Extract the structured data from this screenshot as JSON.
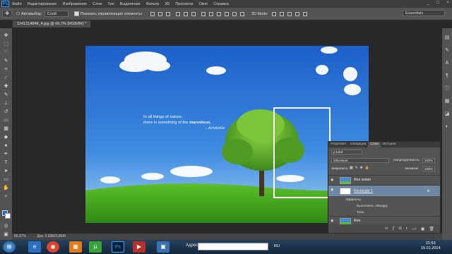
{
  "menu": {
    "items": [
      "Файл",
      "Редактирование",
      "Изображение",
      "Слои",
      "Тип",
      "Выделение",
      "Фильтр",
      "3D",
      "Просмотр",
      "Окно",
      "Справка"
    ]
  },
  "window_controls": [
    "_",
    "□",
    "×"
  ],
  "options_bar": {
    "auto_select_label": "Автовыбор:",
    "auto_select_value": "Слой",
    "show_controls_label": "Показать управляющие элементы",
    "mode_3d_label": "3D Mode:",
    "workspace": "Essentials"
  },
  "document": {
    "tab_title": "1241214848_4.jpg @ 66,7% (RGB/8#) *"
  },
  "canvas": {
    "quote_line1": "In all things of nature,",
    "quote_line2_pre": "there is something of the ",
    "quote_line2_bold": "marvelous.",
    "quote_signature": "- Aristotle"
  },
  "status": {
    "zoom": "66,67%",
    "doc_size": "Док: 2,93М/3,86М"
  },
  "layers_panel": {
    "tabs": [
      "Properties",
      "Операции",
      "Слои",
      "История"
    ],
    "active_tab": "Слои",
    "kind_label": "Kind",
    "blend_mode": "Обычные",
    "opacity_label": "Непрозрачность:",
    "opacity_value": "100%",
    "lock_label": "Закрепить:",
    "fill_label": "Заливка:",
    "fill_value": "100%",
    "layers": [
      {
        "name": "Фон копия",
        "selected": false
      },
      {
        "name": "Rectangle 1",
        "selected": true,
        "fx": "fx"
      },
      {
        "name": "Фон",
        "selected": false
      }
    ],
    "effects_label": "Эффекты",
    "effect_items": [
      "Выполнить обводку",
      "Тень"
    ]
  },
  "taskbar": {
    "address_label": "Адрес",
    "language": "RU",
    "time": "21:53",
    "date": "15.01.2014",
    "colors": {
      "photoshop": "#001e36",
      "utorrent": "#3ba23b",
      "chrome": "#d8442e"
    }
  },
  "icons": [
    "photoshop-logo",
    "move-tool",
    "marquee-tool",
    "lasso-tool",
    "brush-tool",
    "eye-icon",
    "trash-icon",
    "windows-start-icon"
  ]
}
